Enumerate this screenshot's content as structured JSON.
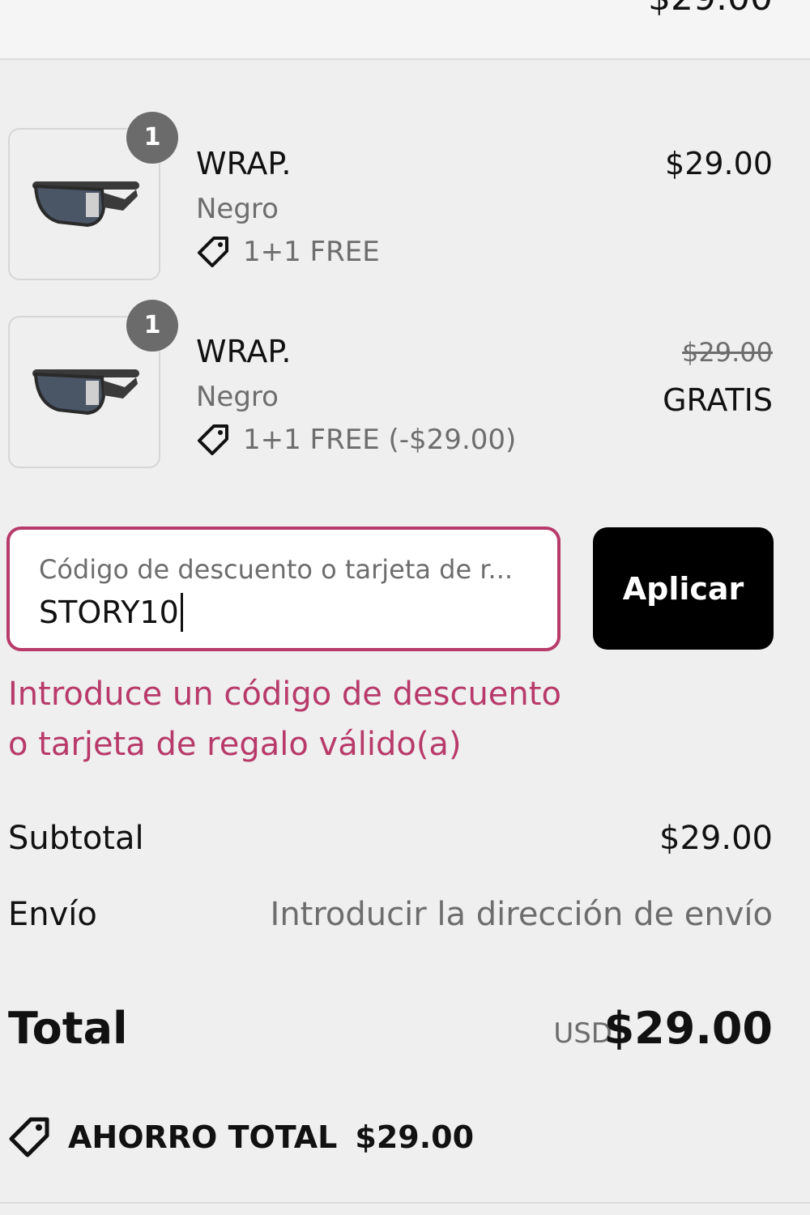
{
  "header": {
    "total_price": "$29.00"
  },
  "items": [
    {
      "quantity": "1",
      "name": "WRAP.",
      "variant": "Negro",
      "discount": "1+1 FREE",
      "price": "$29.00"
    },
    {
      "quantity": "1",
      "name": "WRAP.",
      "variant": "Negro",
      "discount": "1+1 FREE (-$29.00)",
      "price_original": "$29.00",
      "price": "GRATIS"
    }
  ],
  "discount_form": {
    "placeholder": "Código de descuento o tarjeta de r...",
    "value": "STORY10",
    "apply_label": "Aplicar",
    "error": "Introduce un código de descuento o tarjeta de regalo válido(a)"
  },
  "summary": {
    "subtotal_label": "Subtotal",
    "subtotal_value": "$29.00",
    "shipping_label": "Envío",
    "shipping_value": "Introducir la dirección de envío",
    "total_label": "Total",
    "total_currency": "USD",
    "total_value": "$29.00",
    "savings_label": "AHORRO TOTAL",
    "savings_value": "$29.00"
  },
  "colors": {
    "accent_error": "#b83a6a",
    "button_bg": "#000000",
    "muted_text": "#6d6d6d"
  },
  "icons": {
    "tag": "tag-icon"
  }
}
